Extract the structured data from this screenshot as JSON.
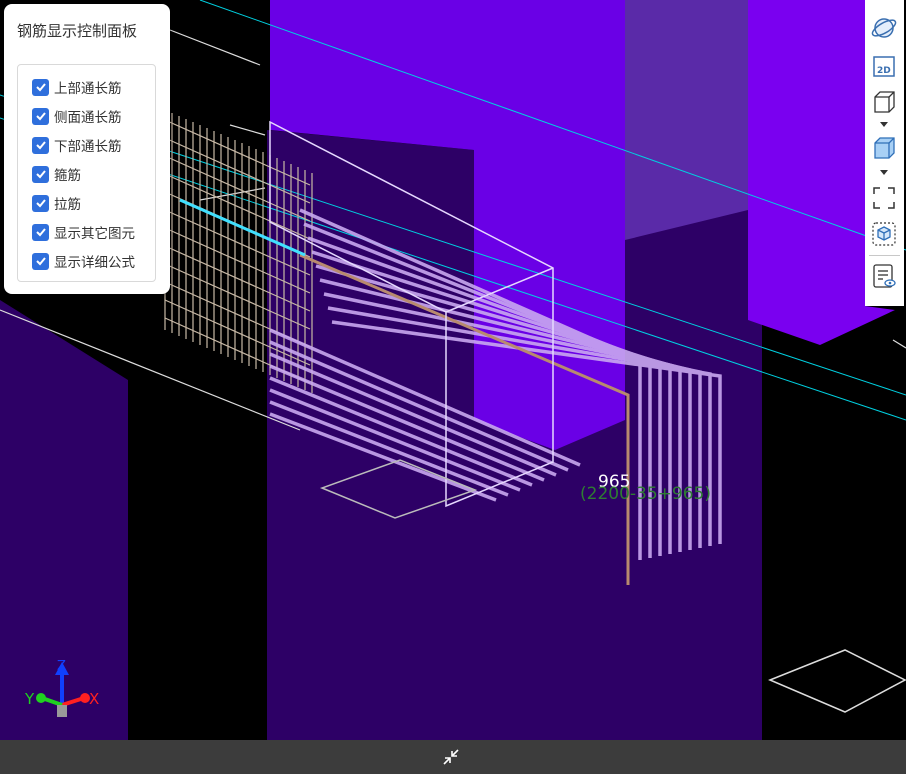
{
  "panel": {
    "title": "钢筋显示控制面板",
    "options": [
      {
        "label": "上部通长筋",
        "checked": true
      },
      {
        "label": "侧面通长筋",
        "checked": true
      },
      {
        "label": "下部通长筋",
        "checked": true
      },
      {
        "label": "箍筋",
        "checked": true
      },
      {
        "label": "拉筋",
        "checked": true
      },
      {
        "label": "显示其它图元",
        "checked": true
      },
      {
        "label": "显示详细公式",
        "checked": true
      }
    ]
  },
  "toolbar": {
    "items": [
      {
        "icon": "orbit-icon"
      },
      {
        "icon": "2d-view-icon",
        "text": "2D"
      },
      {
        "icon": "wireframe-cube-icon"
      },
      {
        "icon": "solid-cube-icon"
      },
      {
        "icon": "fit-view-icon"
      },
      {
        "icon": "section-box-icon"
      },
      {
        "icon": "property-view-icon"
      }
    ]
  },
  "dimension": {
    "value": "965",
    "formula": "(2200-35+965)"
  },
  "axes": {
    "x": "X",
    "y": "Y",
    "z": "Z"
  },
  "colors": {
    "column_bright": "#6a00e6",
    "column_dark": "#2d0066",
    "rebar": "#c9a8f0",
    "stirrup": "#c8b9a6",
    "highlight_bar": "#b88a6e",
    "axis_line": "#00d0e0",
    "checkbox": "#2f6fdc",
    "formula": "#2e7d32"
  }
}
